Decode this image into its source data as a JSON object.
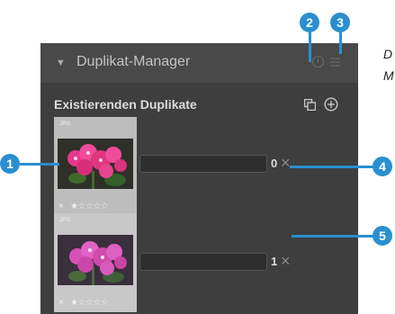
{
  "panel": {
    "collapse_icon": "triangle-down-icon",
    "title": "Duplikat-Manager",
    "info_icon": "info-icon",
    "menu_icon": "hamburger-icon"
  },
  "section": {
    "title": "Existierenden Duplikate",
    "copy_icon": "copy-icon",
    "add_icon": "plus-circle-icon"
  },
  "duplicates": [
    {
      "format": "JPG",
      "rating": 1,
      "max_rating": 5,
      "number": "0",
      "stars": "★☆☆☆☆"
    },
    {
      "format": "JPG",
      "rating": 1,
      "max_rating": 5,
      "number": "1",
      "stars": "★☆☆☆☆"
    }
  ],
  "reject_symbol": "×",
  "remove_symbol": "×",
  "side_text": {
    "line1": "D",
    "line2": "M"
  },
  "callouts": [
    "1",
    "2",
    "3",
    "4",
    "5"
  ],
  "colors": {
    "callout": "#2a8fcf",
    "panel_bg": "#3e3e3e",
    "header_bg": "#494949"
  }
}
